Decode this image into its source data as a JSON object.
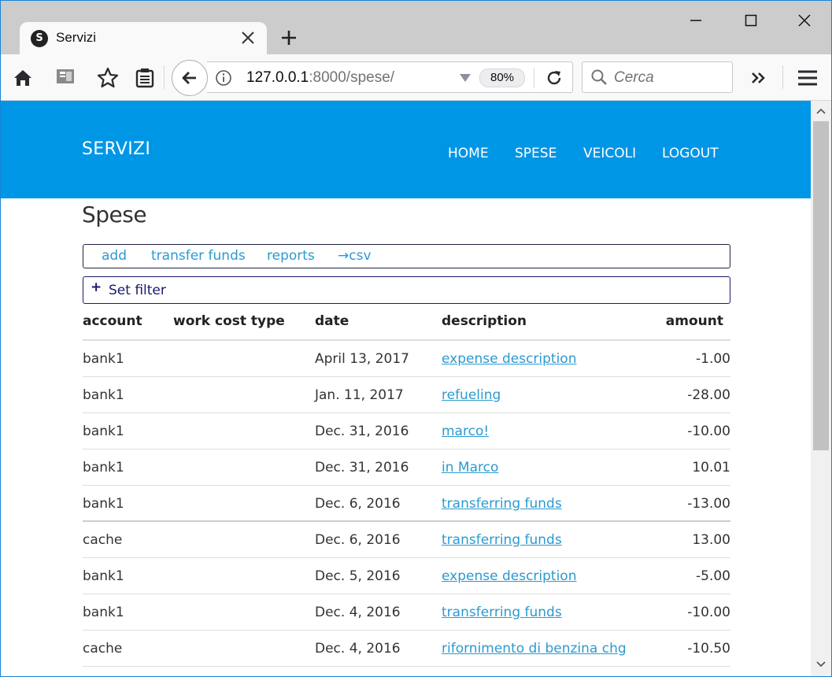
{
  "browser": {
    "tab_title": "Servizi",
    "tab_favicon_letter": "S",
    "url_host": "127.0.0.1",
    "url_rest": ":8000/spese/",
    "zoom": "80%",
    "search_placeholder": "Cerca"
  },
  "site": {
    "brand": "SERVIZI",
    "nav": [
      {
        "label": "HOME"
      },
      {
        "label": "SPESE"
      },
      {
        "label": "VEICOLI"
      },
      {
        "label": "LOGOUT"
      }
    ],
    "accent_color": "#0096e6",
    "link_color": "#2b9ad0"
  },
  "page": {
    "title": "Spese",
    "actions": [
      {
        "label": "add"
      },
      {
        "label": "transfer funds"
      },
      {
        "label": "reports"
      },
      {
        "label": "→csv"
      }
    ],
    "filter": {
      "icon": "+",
      "label": "Set filter"
    }
  },
  "table": {
    "columns": [
      "account",
      "work cost type",
      "date",
      "description",
      "amount"
    ],
    "rows": [
      {
        "account": "bank1",
        "work_cost_type": "",
        "date": "April 13, 2017",
        "description": "expense description",
        "amount": "-1.00"
      },
      {
        "account": "bank1",
        "work_cost_type": "",
        "date": "Jan. 11, 2017",
        "description": "refueling",
        "amount": "-28.00"
      },
      {
        "account": "bank1",
        "work_cost_type": "",
        "date": "Dec. 31, 2016",
        "description": "marco!",
        "amount": "-10.00"
      },
      {
        "account": "bank1",
        "work_cost_type": "",
        "date": "Dec. 31, 2016",
        "description": "in Marco",
        "amount": "10.01"
      },
      {
        "account": "bank1",
        "work_cost_type": "",
        "date": "Dec. 6, 2016",
        "description": "transferring funds",
        "amount": "-13.00"
      },
      {
        "account": "cache",
        "work_cost_type": "",
        "date": "Dec. 6, 2016",
        "description": "transferring funds",
        "amount": "13.00"
      },
      {
        "account": "bank1",
        "work_cost_type": "",
        "date": "Dec. 5, 2016",
        "description": "expense description",
        "amount": "-5.00"
      },
      {
        "account": "bank1",
        "work_cost_type": "",
        "date": "Dec. 4, 2016",
        "description": "transferring funds",
        "amount": "-10.00"
      },
      {
        "account": "cache",
        "work_cost_type": "",
        "date": "Dec. 4, 2016",
        "description": "rifornimento di benzina chg",
        "amount": "-10.50"
      }
    ]
  }
}
